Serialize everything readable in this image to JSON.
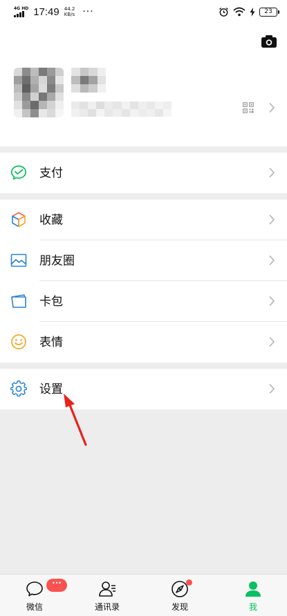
{
  "status_bar": {
    "network": "4G HD",
    "time": "17:49",
    "speed_value": "44.2",
    "speed_unit": "KB/s",
    "more": "···",
    "battery": "23",
    "icons": [
      "signal-icon",
      "alarm-icon",
      "wifi-icon",
      "charging-icon",
      "battery-icon"
    ]
  },
  "profile": {
    "camera_icon": "camera-icon",
    "avatar": "blurred-avatar",
    "qr_icon": "qr-code-icon",
    "arrow_icon": "chevron-right-icon"
  },
  "menu": {
    "pay": {
      "label": "支付",
      "icon": "wechat-pay-icon",
      "color": "#07c160"
    },
    "favorites": {
      "label": "收藏",
      "icon": "favorites-cube-icon"
    },
    "moments": {
      "label": "朋友圈",
      "icon": "album-picture-icon",
      "color": "#2782d7"
    },
    "cards": {
      "label": "卡包",
      "icon": "card-wallet-icon",
      "color": "#2782d7"
    },
    "stickers": {
      "label": "表情",
      "icon": "smiley-icon",
      "color": "#f5a623"
    },
    "settings": {
      "label": "设置",
      "icon": "gear-icon",
      "color": "#2782d7"
    }
  },
  "tabbar": {
    "chats": {
      "label": "微信",
      "icon": "chat-bubble-icon",
      "badge": "···"
    },
    "contacts": {
      "label": "通讯录",
      "icon": "contacts-icon"
    },
    "discover": {
      "label": "发现",
      "icon": "compass-icon"
    },
    "me": {
      "label": "我",
      "icon": "person-icon",
      "active": true
    }
  },
  "colors": {
    "accent": "#07c160",
    "badge": "#fa5151",
    "background": "#ededed",
    "annotation_arrow": "#e8231c"
  }
}
